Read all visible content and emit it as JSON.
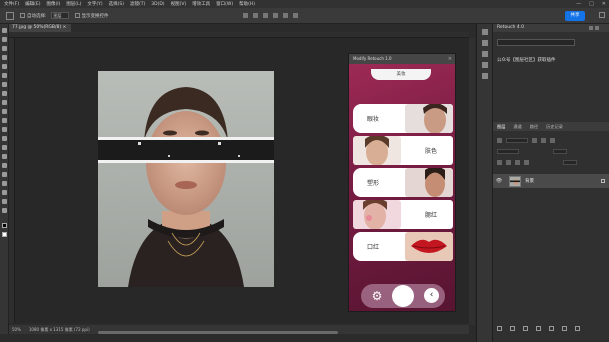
{
  "menubar": {
    "items": [
      "文件(F)",
      "编辑(E)",
      "图像(I)",
      "图层(L)",
      "文字(Y)",
      "选择(S)",
      "滤镜(T)",
      "3D(D)",
      "视图(V)",
      "增效工具",
      "窗口(W)",
      "帮助(H)"
    ],
    "window_buttons": [
      "—",
      "□",
      "✕"
    ]
  },
  "options": {
    "auto_select_label": "自动选择:",
    "layer_select_value": "图层",
    "show_transform_label": "显示变换控件",
    "share_label": "共享"
  },
  "document": {
    "tab_label": "77.jpg @ 50%(RGB/8) ×"
  },
  "status": {
    "zoom": "50%",
    "doc_info": "1080 像素 x 1315 像素 (72 ppi)"
  },
  "plugin": {
    "title": "Modify Retouch 1.0",
    "top_button": "美妆",
    "cards": [
      {
        "label": "眼妆",
        "side": "left"
      },
      {
        "label": "肤色",
        "side": "right"
      },
      {
        "label": "塑形",
        "side": "left"
      },
      {
        "label": "腮红",
        "side": "right"
      },
      {
        "label": "口红",
        "side": "left"
      }
    ],
    "colors": {
      "panel_dark": "#561430",
      "panel_light": "#9d2a55"
    }
  },
  "right_panel": {
    "tab_title": "Retouch 4.0",
    "link_text": "公众号【图层社区】获取插件",
    "layers_tabs": [
      "图层",
      "通道",
      "路径",
      "历史记录"
    ],
    "layer_name": "背景",
    "layer_eye": "👁"
  },
  "colors": {
    "accent": "#1473e6",
    "ui_bg": "#2b2b2b"
  }
}
